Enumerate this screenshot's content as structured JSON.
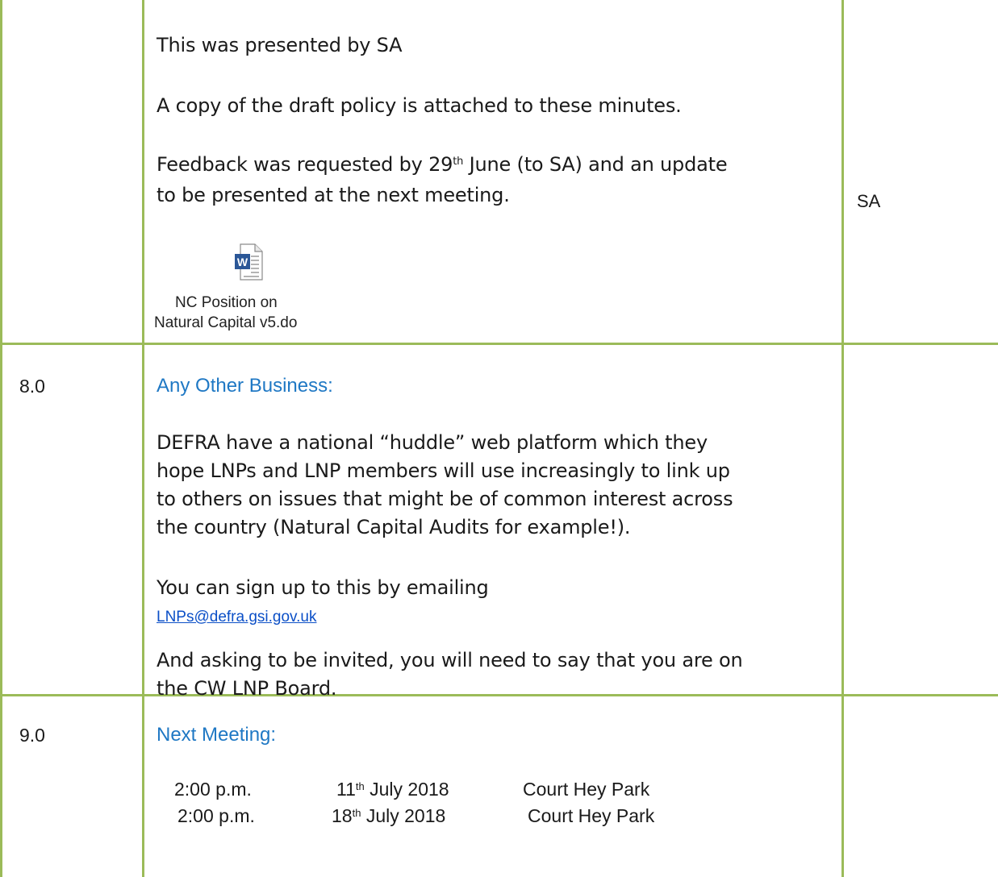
{
  "rows": [
    {
      "num": "",
      "paragraphs": {
        "p1": "This was presented by SA",
        "p2": "A copy of the draft policy is attached to these minutes.",
        "p3_pre": "Feedback was requested by 29",
        "p3_sup": "th",
        "p3_post_line1": " June (to SA) and an update",
        "p3_line2": "to be presented at the next meeting."
      },
      "attachment": {
        "icon": "word-document-icon",
        "label_line1": "NC Position on",
        "label_line2": "Natural Capital v5.do"
      },
      "action": "SA"
    },
    {
      "num": "8.0",
      "heading": "Any Other Business:",
      "lines": [
        "DEFRA have a national “huddle” web platform  which they",
        "hope LNPs and LNP members will use increasingly to link up",
        "to others on issues that might be of common interest across",
        "the country (Natural Capital Audits for example!)."
      ],
      "signup": "You can sign up to this by emailing",
      "email": "LNPs@defra.gsi.gov.uk",
      "closing_line1": "And asking to be invited, you will need to say that you are on",
      "closing_line2": "the CW LNP Board.",
      "action": ""
    },
    {
      "num": "9.0",
      "heading": "Next Meeting:",
      "meetings": [
        {
          "time": "2:00 p.m.",
          "day": "11",
          "sup": "th",
          "month_year": " July 2018",
          "venue": "Court Hey Park"
        },
        {
          "time": "2:00 p.m.",
          "day": "18",
          "sup": "th",
          "month_year": " July 2018",
          "venue": "Court Hey Park"
        }
      ],
      "action": ""
    }
  ],
  "colors": {
    "grid": "#9bbb59",
    "heading": "#1f78c4",
    "link": "#0b4fc7"
  }
}
